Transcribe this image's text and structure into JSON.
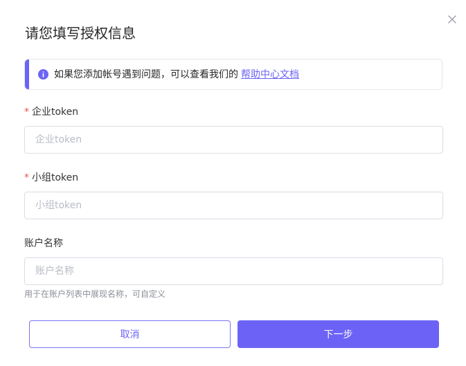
{
  "dialog": {
    "title": "请您填写授权信息",
    "close_icon": "close-icon",
    "accent_color": "#6c63f6"
  },
  "notice": {
    "icon": "info-icon",
    "text": "如果您添加帐号遇到问题，可以查看我们的",
    "link_text": "帮助中心文档"
  },
  "form": {
    "enterprise_token": {
      "required_mark": "*",
      "label": "企业token",
      "placeholder": "企业token",
      "value": ""
    },
    "group_token": {
      "required_mark": "*",
      "label": "小组token",
      "placeholder": "小组token",
      "value": ""
    },
    "account_name": {
      "label": "账户名称",
      "placeholder": "账户名称",
      "value": "",
      "hint": "用于在账户列表中展现名称，可自定义"
    }
  },
  "actions": {
    "cancel_label": "取消",
    "next_label": "下一步"
  }
}
